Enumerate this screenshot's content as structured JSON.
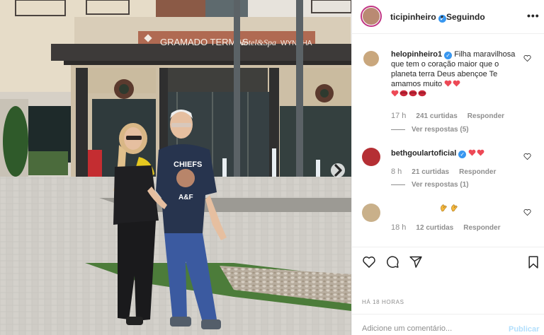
{
  "photo": {
    "hotel_sign": "GRAMADO TERMAS",
    "hotel_sign_script": "Hotel&Spa",
    "hotel_brand": "WYNDHA",
    "shirt_line1": "CHIEFS",
    "shirt_line2": "A&F"
  },
  "post": {
    "username": "ticipinheiro",
    "separator": "•",
    "follow_status": "Seguindo",
    "more_label": "•••",
    "time_ago": "HÁ 18 HORAS"
  },
  "comments": [
    {
      "username": "helopinheiro1",
      "text": "Filha maravilhosa que tem o coração maior que o planeta terra Deus abençoe Te amamos muito",
      "time": "17 h",
      "likes": "241 curtidas",
      "reply": "Responder",
      "view_replies": "Ver respostas (5)"
    },
    {
      "username": "bethgoulartoficial",
      "time": "8 h",
      "likes": "21 curtidas",
      "reply": "Responder",
      "view_replies": "Ver respostas (1)"
    },
    {
      "time": "18 h",
      "likes": "12 curtidas",
      "reply": "Responder"
    }
  ],
  "comment_box": {
    "placeholder": "Adicione um comentário...",
    "publish": "Publicar"
  },
  "colors": {
    "verified": "#3897f0",
    "heart": "#ed4956",
    "publish_disabled": "#b2dffc",
    "muted": "#8e8e8e"
  },
  "icons": [
    "verified-badge-icon",
    "heart-icon",
    "comment-icon",
    "share-icon",
    "bookmark-icon",
    "chevron-right-icon",
    "more-icon"
  ]
}
